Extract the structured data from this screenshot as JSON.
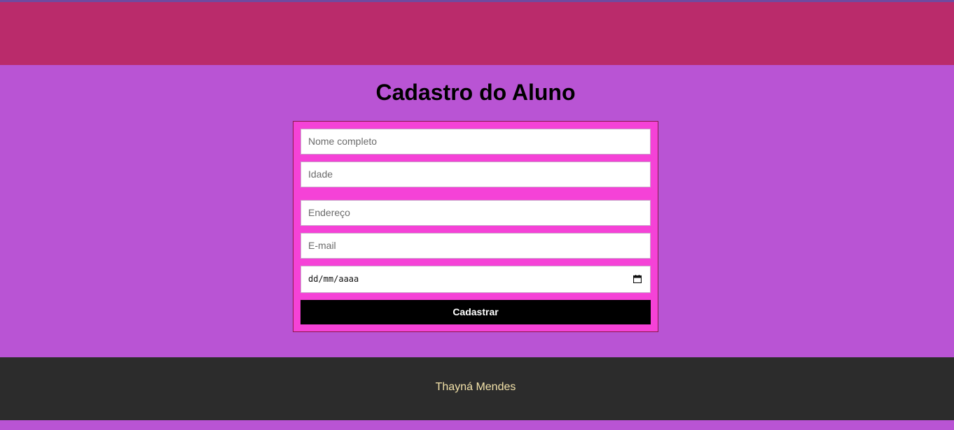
{
  "colors": {
    "header": "#ba2b6b",
    "main_bg": "#b954d4",
    "form_bg": "#f542d7",
    "button_bg": "#000000",
    "footer_bg": "#2c2c2c",
    "footer_text": "#f3e2a9"
  },
  "main": {
    "title": "Cadastro do Aluno"
  },
  "form": {
    "name_placeholder": "Nome completo",
    "age_placeholder": "Idade",
    "address_placeholder": "Endereço",
    "email_placeholder": "E-mail",
    "date_placeholder": "dd/mm/aaaa",
    "submit_label": "Cadastrar"
  },
  "footer": {
    "text": "Thayná Mendes"
  }
}
